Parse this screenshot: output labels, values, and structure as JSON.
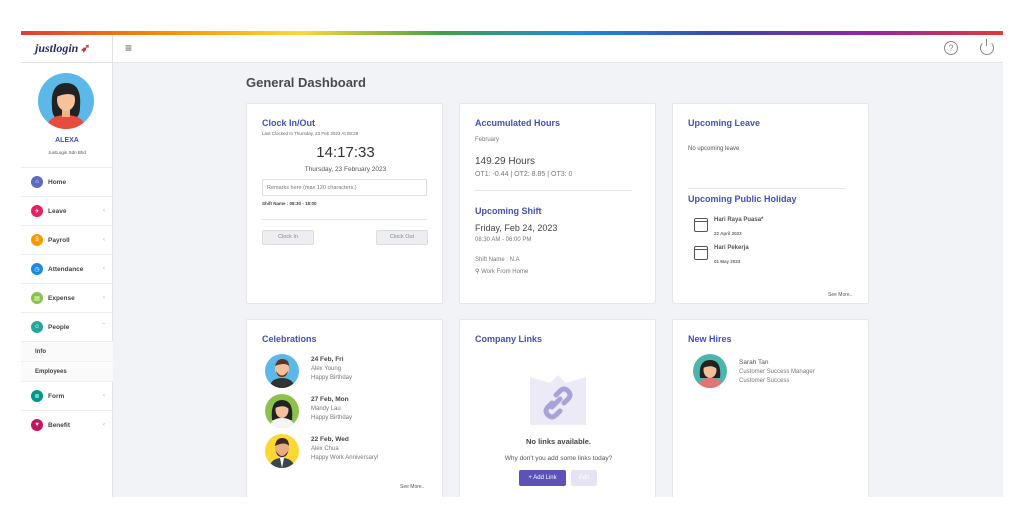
{
  "header": {
    "logo_text": "justlogin",
    "menu_icon": "hamburger-icon",
    "help_icon": "help-icon",
    "power_icon": "power-icon"
  },
  "user": {
    "name": "ALEXA",
    "company": "JustLogin Sdn Bhd"
  },
  "sidebar": {
    "items": [
      {
        "label": "Home",
        "color": "#5c6bc0",
        "chevron": false
      },
      {
        "label": "Leave",
        "color": "#e91e63",
        "chevron": true
      },
      {
        "label": "Payroll",
        "color": "#ff9800",
        "chevron": true
      },
      {
        "label": "Attendance",
        "color": "#1e88e5",
        "chevron": true
      },
      {
        "label": "Expense",
        "color": "#8bc34a",
        "chevron": true
      },
      {
        "label": "People",
        "color": "#26a69a",
        "chevron": true
      }
    ],
    "sub_items": [
      "Info",
      "Employees"
    ],
    "items_after": [
      {
        "label": "Form",
        "color": "#009688",
        "chevron": true
      },
      {
        "label": "Benefit",
        "color": "#c2185b",
        "chevron": true
      }
    ]
  },
  "page": {
    "title": "General Dashboard"
  },
  "clock": {
    "title": "Clock In/Out",
    "last_clocked": "Last Clocked In Thursday, 23 Feb 2023 At 08:28",
    "time": "14:17:33",
    "date": "Thursday, 23 February 2023",
    "remarks_placeholder": "Remarks here (max 120 characters.)",
    "shift": "Shift Name : 08:30 - 18:00",
    "clock_in_label": "Clock In",
    "clock_out_label": "Clock Out"
  },
  "hours": {
    "title": "Accumulated Hours",
    "month": "February",
    "total": "149.29 Hours",
    "ot_breakdown": "OT1: -0.44 | OT2: 8.85 | OT3: 0",
    "shift_title": "Upcoming Shift",
    "shift_date": "Friday, Feb 24, 2023",
    "shift_time": "08:30 AM - 06:00 PM",
    "shift_name": "Shift Name : N.A",
    "location": "Work From Home"
  },
  "leave": {
    "title": "Upcoming Leave",
    "empty_text": "No upcoming leave",
    "holiday_title": "Upcoming Public Holiday",
    "holidays": [
      {
        "name": "Hari Raya Puasa*",
        "date": "22 April 2023"
      },
      {
        "name": "Hari Pekerja",
        "date": "01 May 2023"
      }
    ],
    "see_more": "See More.."
  },
  "celebrations": {
    "title": "Celebrations",
    "items": [
      {
        "date": "24 Feb, Fri",
        "name": "Alex Young",
        "message": "Happy Birthday"
      },
      {
        "date": "27 Feb, Mon",
        "name": "Mandy Lau",
        "message": "Happy Birthday"
      },
      {
        "date": "22 Feb, Wed",
        "name": "Alex Chua",
        "message": "Happy Work Anniversary!"
      }
    ],
    "see_more": "See More.."
  },
  "links": {
    "title": "Company Links",
    "empty_title": "No links available.",
    "empty_sub": "Why don't you add some links today?",
    "add_label": "+ Add Link",
    "edit_label": "Edit",
    "accent": "#5c52b8"
  },
  "hires": {
    "title": "New Hires",
    "items": [
      {
        "name": "Sarah Tan",
        "role": "Customer Success Manager",
        "dept": "Customer Success"
      }
    ]
  }
}
